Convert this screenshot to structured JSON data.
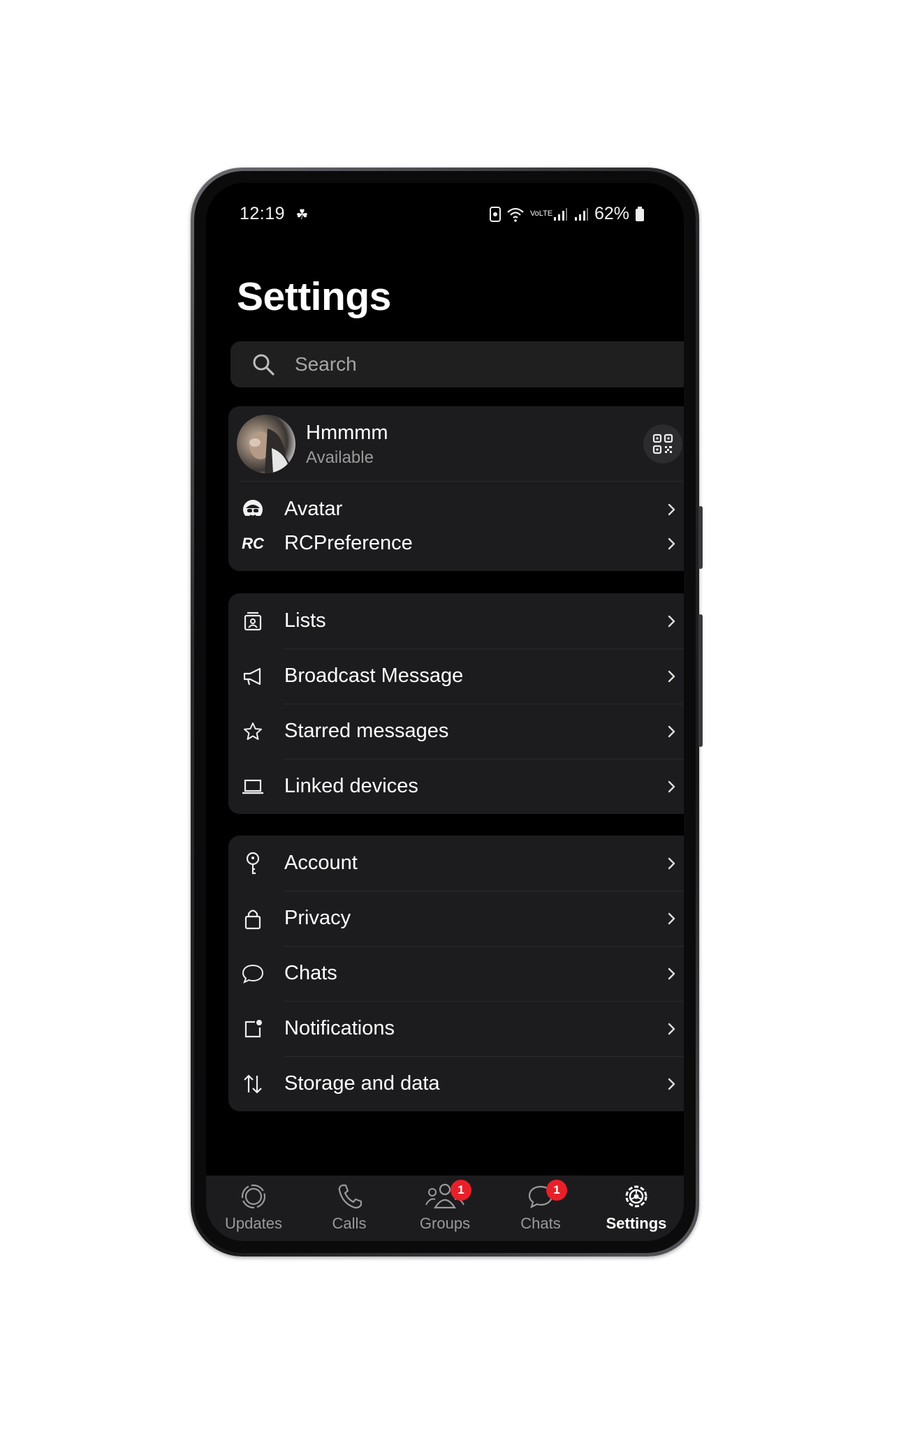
{
  "status_bar": {
    "time": "12:19",
    "battery": "62%",
    "network": "VoLTE"
  },
  "page_title": "Settings",
  "search": {
    "placeholder": "Search"
  },
  "profile": {
    "name": "Hmmmm",
    "status": "Available"
  },
  "card_profile": [
    {
      "label": "Avatar",
      "icon": "avatar-icon"
    }
  ],
  "card_rc": [
    {
      "label": "RCPreference",
      "icon": "rc-logo-icon"
    }
  ],
  "card_tools": [
    {
      "label": "Lists",
      "icon": "lists-icon"
    },
    {
      "label": "Broadcast Message",
      "icon": "megaphone-icon"
    },
    {
      "label": "Starred messages",
      "icon": "star-icon"
    },
    {
      "label": "Linked devices",
      "icon": "laptop-icon"
    }
  ],
  "card_settings": [
    {
      "label": "Account",
      "icon": "key-icon"
    },
    {
      "label": "Privacy",
      "icon": "lock-icon"
    },
    {
      "label": "Chats",
      "icon": "chat-bubble-icon"
    },
    {
      "label": "Notifications",
      "icon": "notification-icon"
    },
    {
      "label": "Storage and data",
      "icon": "storage-arrows-icon"
    }
  ],
  "bottom_nav": [
    {
      "label": "Updates",
      "icon": "updates-icon",
      "badge": ""
    },
    {
      "label": "Calls",
      "icon": "phone-icon",
      "badge": ""
    },
    {
      "label": "Groups",
      "icon": "groups-icon",
      "badge": "1"
    },
    {
      "label": "Chats",
      "icon": "chats-icon",
      "badge": "1"
    },
    {
      "label": "Settings",
      "icon": "settings-gear-icon",
      "badge": "",
      "active": true
    }
  ],
  "colors": {
    "background": "#000000",
    "card": "#1c1c1e",
    "text": "#ffffff",
    "muted": "#9a9a9a",
    "badge": "#e8202a"
  }
}
